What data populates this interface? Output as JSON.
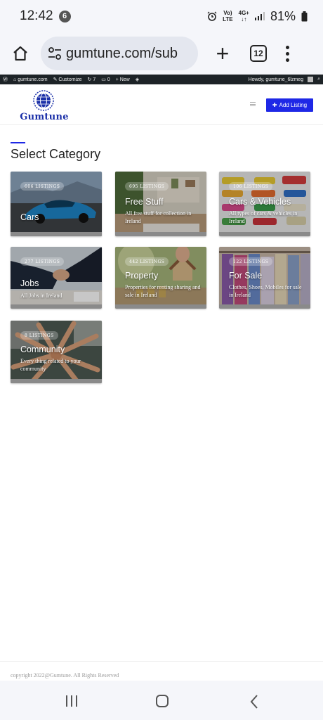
{
  "status": {
    "time": "12:42",
    "notif_count": "6",
    "battery": "81%",
    "network_top": "Vo)",
    "network_bottom": "LTE",
    "signal_type": "4G+"
  },
  "browser": {
    "url": "gumtune.com/sub",
    "tab_count": "12"
  },
  "wp_admin": {
    "site": "gumtune.com",
    "customize": "Customize",
    "updates": "7",
    "comments": "0",
    "new": "New",
    "howdy": "Howdy, gumtune_6lzmeg"
  },
  "header": {
    "logo_text": "Gumtune",
    "add_listing": "Add Listing"
  },
  "section": {
    "title": "Select Category"
  },
  "categories": [
    {
      "count": "606 LISTINGS",
      "title": "Cars",
      "desc": ""
    },
    {
      "count": "695 LISTINGS",
      "title": "Free Stuff",
      "desc": "All free stuff for collection in Ireland"
    },
    {
      "count": "106 LISTINGS",
      "title": "Cars & Vehicles",
      "desc": "All types of cars & vehicles in Ireland"
    },
    {
      "count": "277 LISTINGS",
      "title": "Jobs",
      "desc": "All Jobs in Ireland"
    },
    {
      "count": "442 LISTINGS",
      "title": "Property",
      "desc": "Properties for renting sharing and sale in Ireland"
    },
    {
      "count": "122 LISTINGS",
      "title": "For Sale",
      "desc": "Clothes, Shoes, Mobiles for sale in Ireland"
    },
    {
      "count": "8 LISTINGS",
      "title": "Community",
      "desc": "Every thing related to your community"
    }
  ],
  "footer": {
    "copyright": "copyright 2022@Gumtune. All Rights Reserved"
  },
  "colors": {
    "accent": "#1e28e6",
    "logo": "#1a2fa8",
    "wpbar": "#1d2327"
  }
}
